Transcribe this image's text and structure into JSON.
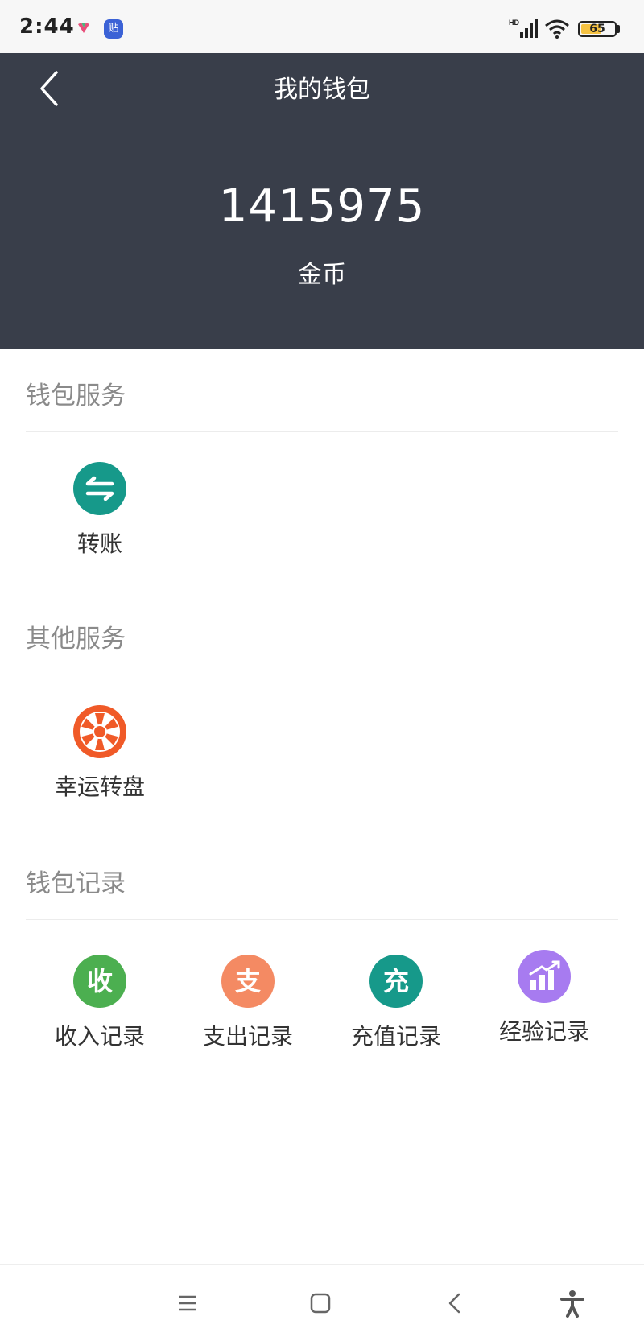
{
  "status_bar": {
    "time": "2:44",
    "notification_icons": [
      "colorful-app-icon",
      "tieba-app-icon"
    ],
    "app_badge_text": "贴",
    "network_label": "HD",
    "battery_level": "65",
    "battery_percent": 65
  },
  "header": {
    "title": "我的钱包",
    "balance": "1415975",
    "balance_unit": "金币",
    "background_color": "#393e4a"
  },
  "sections": [
    {
      "title": "钱包服务",
      "items": [
        {
          "label": "转账",
          "icon": "transfer-icon",
          "color": "#16998a"
        }
      ]
    },
    {
      "title": "其他服务",
      "items": [
        {
          "label": "幸运转盘",
          "icon": "lucky-wheel-icon",
          "color": "#f05a28"
        }
      ]
    },
    {
      "title": "钱包记录",
      "items": [
        {
          "label": "收入记录",
          "icon": "income-icon",
          "glyph": "收",
          "color": "#4caf50"
        },
        {
          "label": "支出记录",
          "icon": "expense-icon",
          "glyph": "支",
          "color": "#f48a63"
        },
        {
          "label": "充值记录",
          "icon": "recharge-icon",
          "glyph": "充",
          "color": "#16998a"
        },
        {
          "label": "经验记录",
          "icon": "experience-chart-icon",
          "color": "#a77bf0"
        }
      ]
    }
  ],
  "nav_bar": {
    "buttons": [
      "menu-icon",
      "home-icon",
      "back-icon",
      "accessibility-icon"
    ]
  }
}
